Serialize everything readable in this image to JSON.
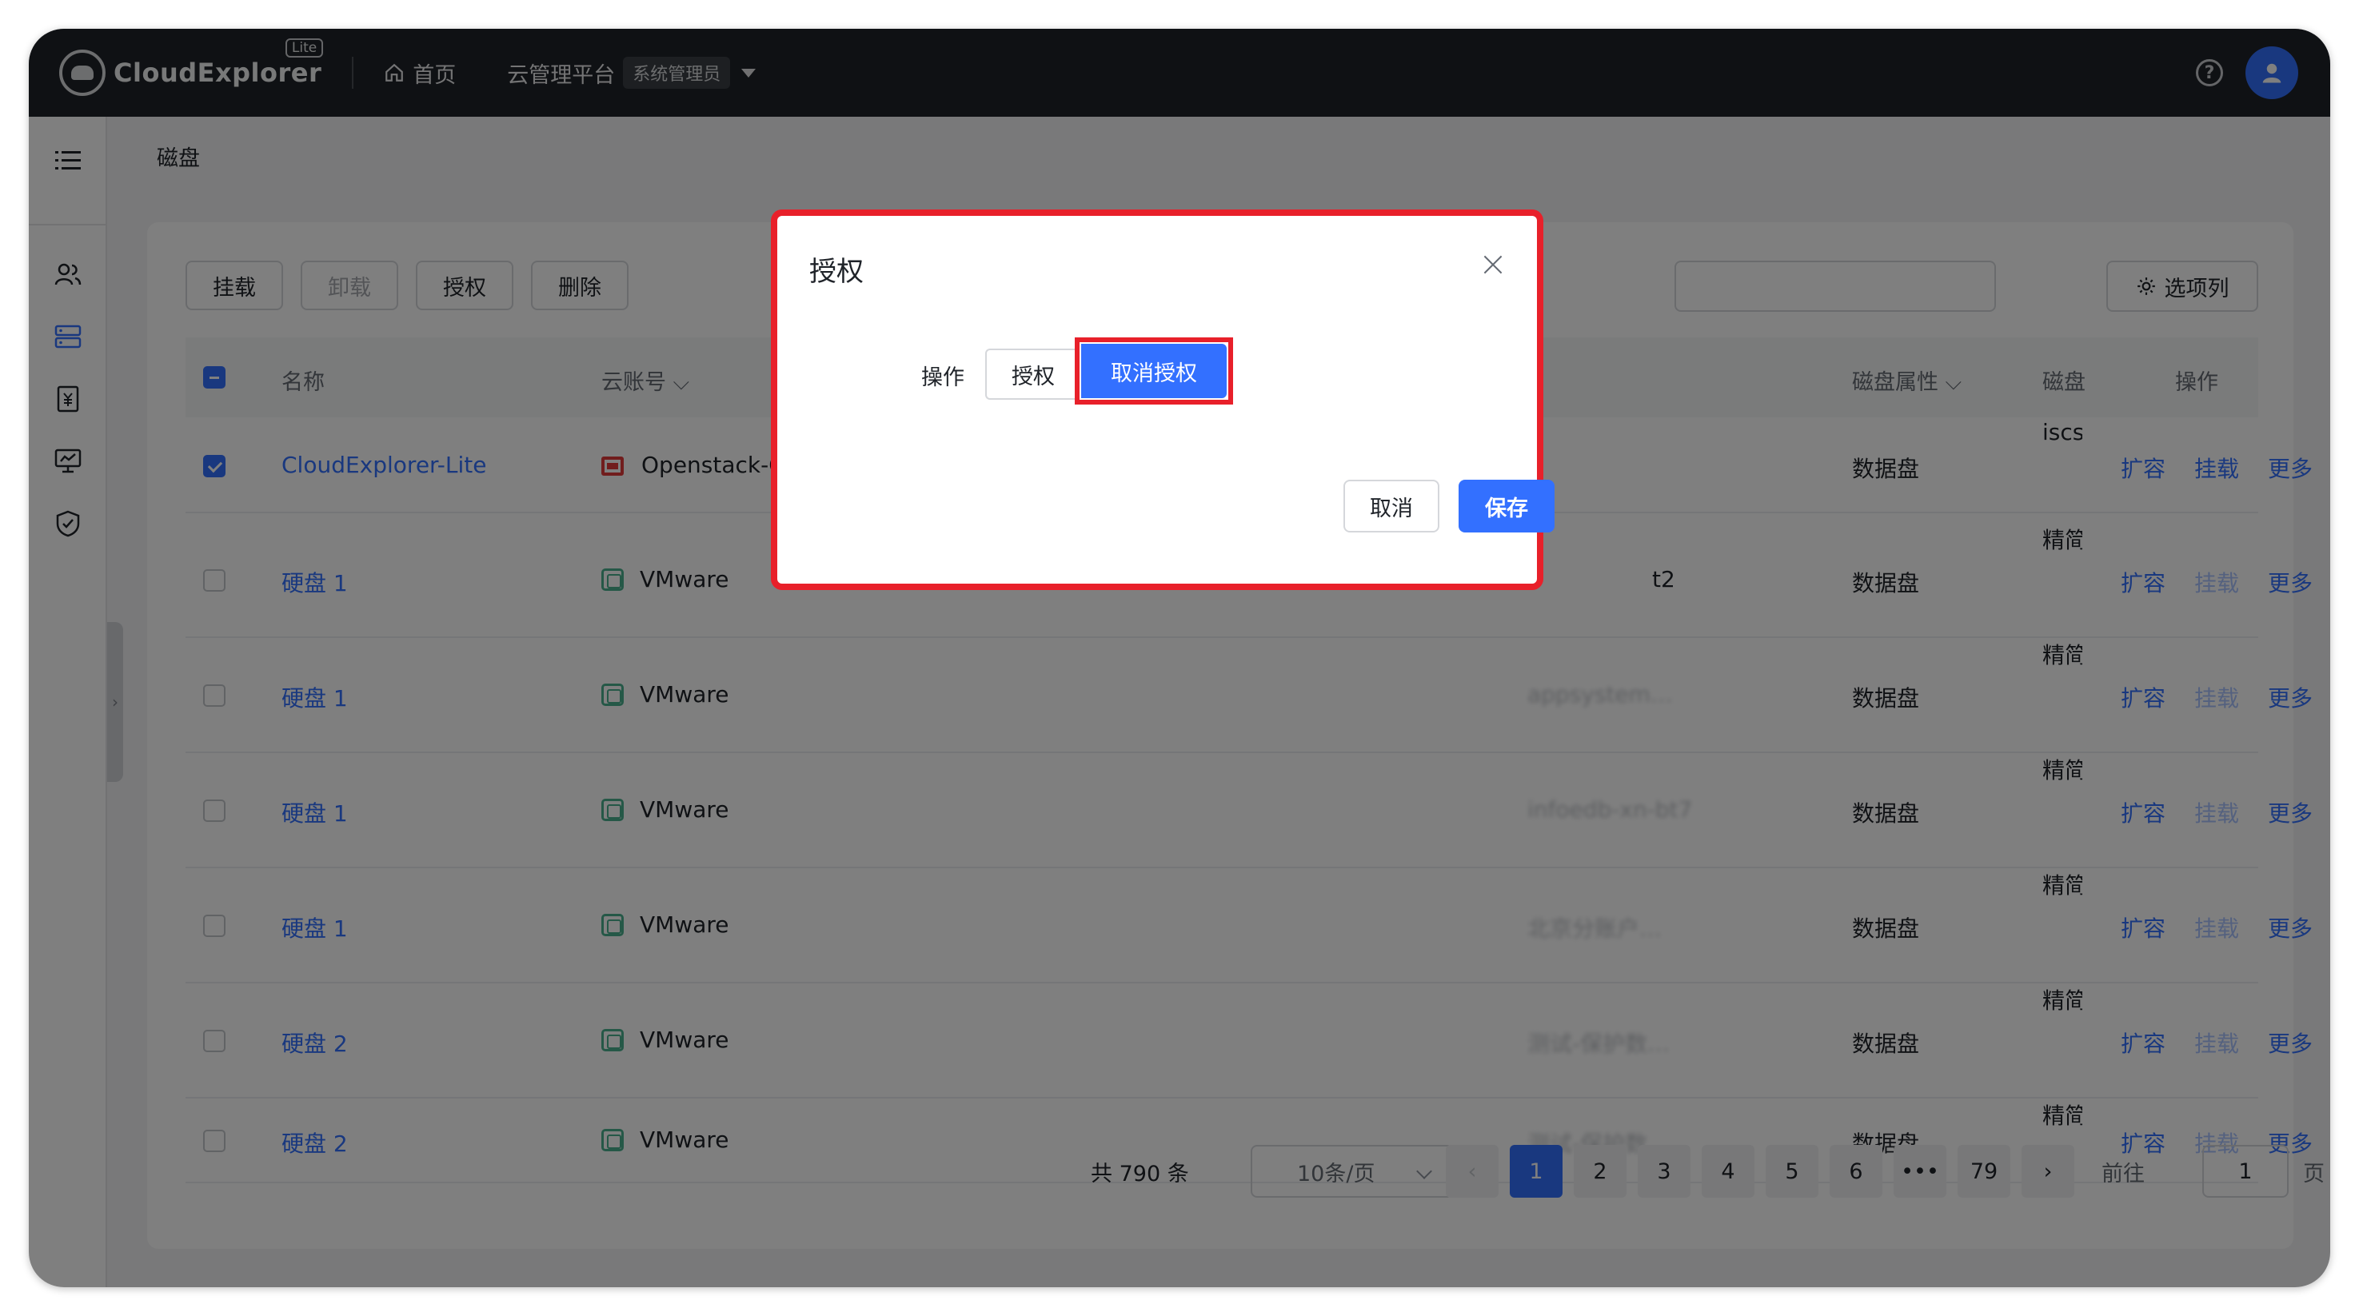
{
  "topbar": {
    "logo_text": "CloudExplorer",
    "logo_badge": "Lite",
    "home_label": "首页",
    "platform_label": "云管理平台",
    "role_label": "系统管理员"
  },
  "sidebar": {
    "items": [
      "menu-toggle-icon",
      "users-icon",
      "disk-icon",
      "bill-icon",
      "monitor-icon",
      "shield-icon"
    ]
  },
  "breadcrumb": "磁盘",
  "toolbar": {
    "mount": "挂载",
    "unmount": "卸载",
    "authorize": "授权",
    "delete": "删除",
    "columns": "选项列"
  },
  "table": {
    "headers": {
      "name": "名称",
      "cloud_account": "云账号",
      "disk_attr": "磁盘属性",
      "disk_type": "磁盘",
      "actions": "操作"
    },
    "rows": [
      {
        "name": "CloudExplorer-Lite",
        "account": "Openstack-C",
        "attr": "数据盘",
        "type": "iscs",
        "a1": "扩容",
        "a2": "挂载",
        "a3": "更多",
        "extra": ""
      },
      {
        "name": "硬盘 1",
        "account": "VMware",
        "attr": "数据盘",
        "type": "精简",
        "a1": "扩容",
        "a2": "挂载",
        "a3": "更多",
        "extra": "t2"
      },
      {
        "name": "硬盘 1",
        "account": "VMware",
        "attr": "数据盘",
        "type": "精简",
        "a1": "扩容",
        "a2": "挂载",
        "a3": "更多",
        "extra": "appsystem…"
      },
      {
        "name": "硬盘 1",
        "account": "VMware",
        "attr": "数据盘",
        "type": "精简",
        "a1": "扩容",
        "a2": "挂载",
        "a3": "更多",
        "extra": "infoedb-xn-bt7"
      },
      {
        "name": "硬盘 1",
        "account": "VMware",
        "attr": "数据盘",
        "type": "精简",
        "a1": "扩容",
        "a2": "挂载",
        "a3": "更多",
        "extra": "北京分账户…"
      },
      {
        "name": "硬盘 2",
        "account": "VMware",
        "attr": "数据盘",
        "type": "精简",
        "a1": "扩容",
        "a2": "挂载",
        "a3": "更多",
        "extra": "测试-保护数…"
      },
      {
        "name": "硬盘 2",
        "account": "VMware",
        "attr": "数据盘",
        "type": "精简",
        "a1": "扩容",
        "a2": "挂载",
        "a3": "更多",
        "extra": "测试-保护数…"
      }
    ]
  },
  "pagination": {
    "total": "共 790 条",
    "page_size": "10条/页",
    "pages": [
      "1",
      "2",
      "3",
      "4",
      "5",
      "6",
      "•••",
      "79"
    ],
    "goto_label": "前往",
    "goto_value": "1",
    "page_suffix": "页",
    "prev": "‹",
    "next": "›"
  },
  "modal": {
    "title": "授权",
    "field_label": "操作",
    "option_authorize": "授权",
    "option_unauthorize": "取消授权",
    "cancel": "取消",
    "save": "保存"
  },
  "colors": {
    "primary": "#3370ff",
    "topbar": "#1f2329",
    "highlight": "#e8202a"
  }
}
